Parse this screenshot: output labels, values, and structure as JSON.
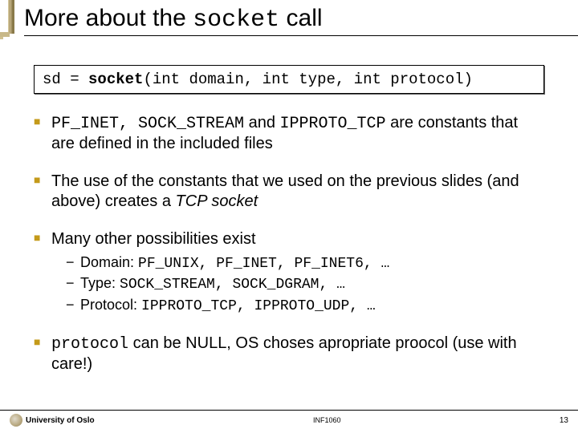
{
  "title": {
    "pre": "More about the ",
    "code": "socket",
    "post": " call"
  },
  "codebox": {
    "prefix": "sd = ",
    "func": "socket",
    "params": "(int domain, int type, int protocol)"
  },
  "bullets": {
    "b1": {
      "c1": "PF_INET, SOCK_STREAM",
      "t1": " and ",
      "c2": "IPPROTO_TCP",
      "t2": " are constants that are defined in the included files"
    },
    "b2": {
      "t1": "The use of the constants that we used on the previous slides (and above) creates a ",
      "i1": "TCP socket"
    },
    "b3": {
      "t1": "Many other possibilities exist",
      "sub1_label": "Domain: ",
      "sub1_code": "PF_UNIX, PF_INET, PF_INET6, …",
      "sub2_label": "Type: ",
      "sub2_code": "SOCK_STREAM, SOCK_DGRAM, …",
      "sub3_label": "Protocol: ",
      "sub3_code": "IPPROTO_TCP, IPPROTO_UDP, …"
    },
    "b4": {
      "c1": "protocol",
      "t1": " can be NULL, OS choses apropriate proocol   (use with care!)"
    }
  },
  "footer": {
    "left": "University of Oslo",
    "center": "INF1060",
    "right": "13"
  }
}
